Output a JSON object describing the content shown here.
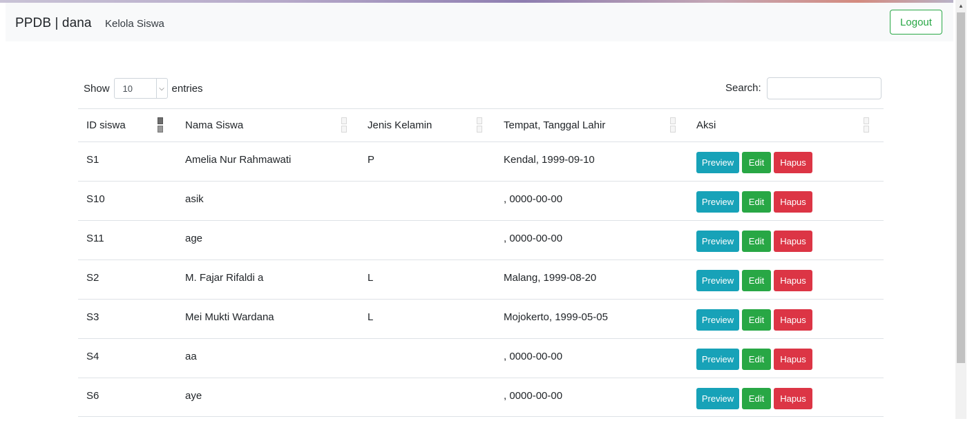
{
  "navbar": {
    "brand": "PPDB | dana",
    "link": "Kelola Siswa",
    "logout_label": "Logout"
  },
  "controls": {
    "show_label": "Show",
    "length_value": "10",
    "entries_label": "entries",
    "search_label": "Search:",
    "search_value": ""
  },
  "table": {
    "headers": [
      "ID siswa",
      "Nama Siswa",
      "Jenis Kelamin",
      "Tempat, Tanggal Lahir",
      "Aksi"
    ],
    "sorted_column": "ID siswa",
    "rows": [
      {
        "id": "S1",
        "nama": "Amelia Nur Rahmawati",
        "jk": "P",
        "ttl": "Kendal, 1999-09-10"
      },
      {
        "id": "S10",
        "nama": "asik",
        "jk": "",
        "ttl": ", 0000-00-00"
      },
      {
        "id": "S11",
        "nama": "age",
        "jk": "",
        "ttl": ", 0000-00-00"
      },
      {
        "id": "S2",
        "nama": "M. Fajar Rifaldi a",
        "jk": "L",
        "ttl": "Malang, 1999-08-20"
      },
      {
        "id": "S3",
        "nama": "Mei Mukti Wardana",
        "jk": "L",
        "ttl": "Mojokerto, 1999-05-05"
      },
      {
        "id": "S4",
        "nama": "aa",
        "jk": "",
        "ttl": ", 0000-00-00"
      },
      {
        "id": "S6",
        "nama": "aye",
        "jk": "",
        "ttl": ", 0000-00-00"
      }
    ],
    "actions": {
      "preview": "Preview",
      "edit": "Edit",
      "hapus": "Hapus"
    }
  },
  "colors": {
    "preview": "#17a2b8",
    "edit": "#28a745",
    "hapus": "#dc3545",
    "navbar_bg": "#f8f9fa"
  }
}
